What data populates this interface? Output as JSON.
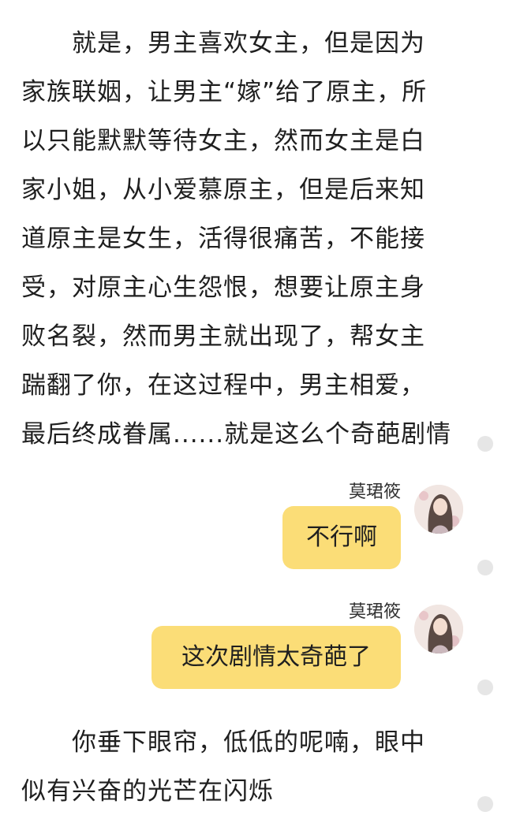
{
  "story_paragraph_1": {
    "lines": [
      "就是，男主喜欢女主，但是因为",
      "家族联姻，让男主“嫁”给了原主，所",
      "以只能默默等待女主，然而女主是白",
      "家小姐，从小爱慕原主，但是后来知",
      "道原主是女生，活得很痛苦，不能接",
      "受，对原主心生怨恨，想要让原主身",
      "败名裂，然而男主就出现了，帮女主",
      "踹翻了你，在这过程中，男主相爱，",
      "最后终成眷属......就是这么个奇葩剧情"
    ]
  },
  "messages": [
    {
      "sender": "莫珺筱",
      "text": "不行啊"
    },
    {
      "sender": "莫珺筱",
      "text": "这次剧情太奇葩了"
    }
  ],
  "story_paragraph_2": {
    "lines": [
      "你垂下眼帘，低低的呢喃，眼中",
      "似有兴奋的光芒在闪烁"
    ]
  },
  "colors": {
    "bubble": "#fbdd77",
    "text": "#1f1f1f",
    "side_dot": "#e6e6e6"
  }
}
